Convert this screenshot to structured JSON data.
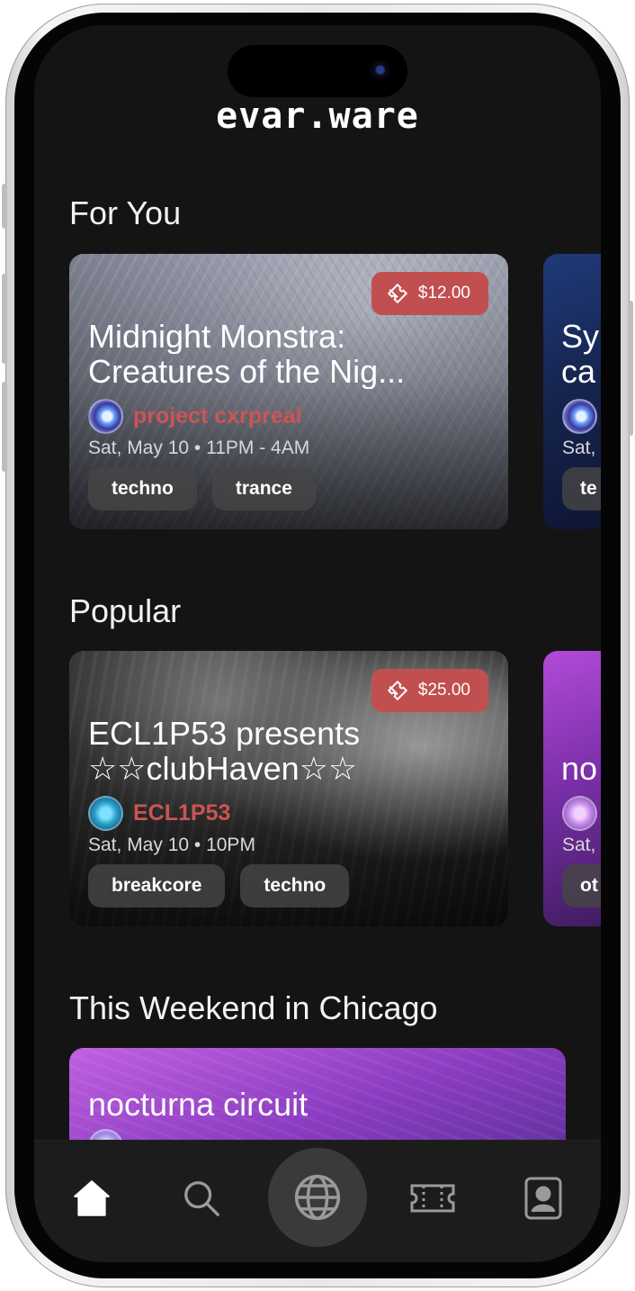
{
  "app": {
    "logo_text": "evar.ware"
  },
  "sections": {
    "for_you": {
      "title": "For You",
      "card": {
        "price": "$12.00",
        "title_line1": "Midnight Monstra:",
        "title_line2": "Creatures of the Nig...",
        "host": "project cxrpreal",
        "when": "Sat, May 10 • 11PM - 4AM",
        "tags": [
          "techno",
          "trance"
        ]
      },
      "peek": {
        "title_line1": "Sy",
        "title_line2": "ca",
        "when": "Sat,",
        "tag": "te"
      }
    },
    "popular": {
      "title": "Popular",
      "card": {
        "price": "$25.00",
        "title_line1": "ECL1P53 presents",
        "title_line2": "☆☆clubHaven☆☆",
        "host": "ECL1P53",
        "when": "Sat, May 10 • 10PM",
        "tags": [
          "breakcore",
          "techno"
        ]
      },
      "peek": {
        "title_line1": "no",
        "when": "Sat,",
        "tag": "ot"
      }
    },
    "weekend": {
      "title": "This Weekend in Chicago",
      "card": {
        "title": "nocturna circuit"
      }
    }
  },
  "tabbar": {
    "items": [
      {
        "icon": "home-icon"
      },
      {
        "icon": "search-icon"
      },
      {
        "icon": "globe-icon"
      },
      {
        "icon": "ticket-icon"
      },
      {
        "icon": "profile-icon"
      }
    ]
  },
  "colors": {
    "accent": "#c24f50",
    "host": "#cc5454",
    "background": "#141414"
  }
}
